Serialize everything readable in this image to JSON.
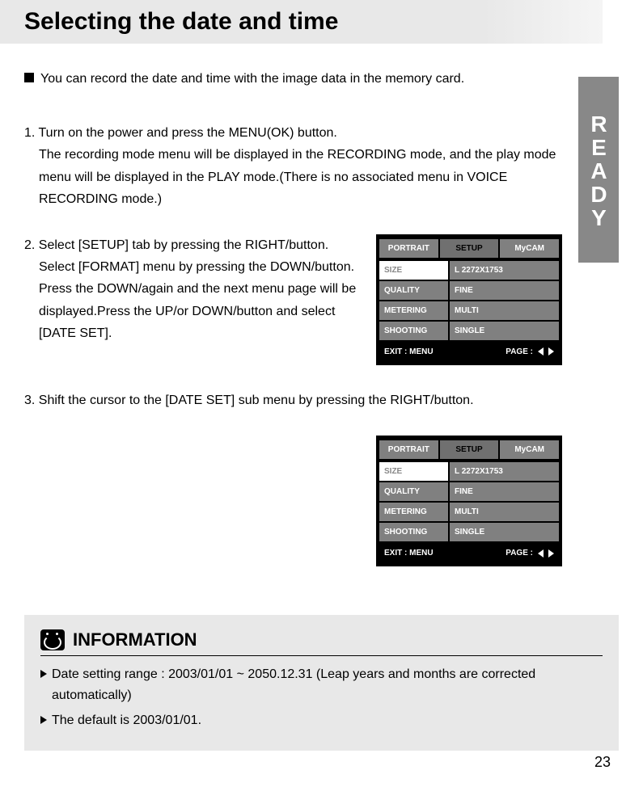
{
  "title": "Selecting the date and time",
  "sideTab": "READY",
  "intro": "You can record the date and time with the image data in the memory card.",
  "step1_line1": "1. Turn on the power and press the MENU(OK) button.",
  "step1_line2": "The recording mode menu will be displayed in the RECORDING mode, and the play mode menu will be displayed in the PLAY mode.(There is no associated menu in VOICE RECORDING mode.)",
  "step2": "2. Select [SETUP] tab by pressing the RIGHT/button. Select [FORMAT] menu by pressing the DOWN/button. Press the DOWN/again and the next menu page will be displayed.Press the UP/or DOWN/button and select [DATE SET].",
  "step3": "3. Shift the cursor to the [DATE SET] sub menu by pressing   the RIGHT/button.",
  "screen": {
    "tabs": {
      "portrait": "PORTRAIT",
      "setup": "SETUP",
      "mycam": "MyCAM"
    },
    "rows": {
      "size": {
        "label": "SIZE",
        "value": "L 2272X1753"
      },
      "quality": {
        "label": "QUALITY",
        "value": "FINE"
      },
      "metering": {
        "label": "METERING",
        "value": "MULTI"
      },
      "shooting": {
        "label": "SHOOTING",
        "value": "SINGLE"
      }
    },
    "exit": "EXIT : MENU",
    "page": "PAGE :"
  },
  "info": {
    "title": "INFORMATION",
    "item1": "Date setting range : 2003/01/01 ~ 2050.12.31 (Leap years and months are corrected automatically)",
    "item2": "The default is 2003/01/01."
  },
  "pageNumber": "23"
}
